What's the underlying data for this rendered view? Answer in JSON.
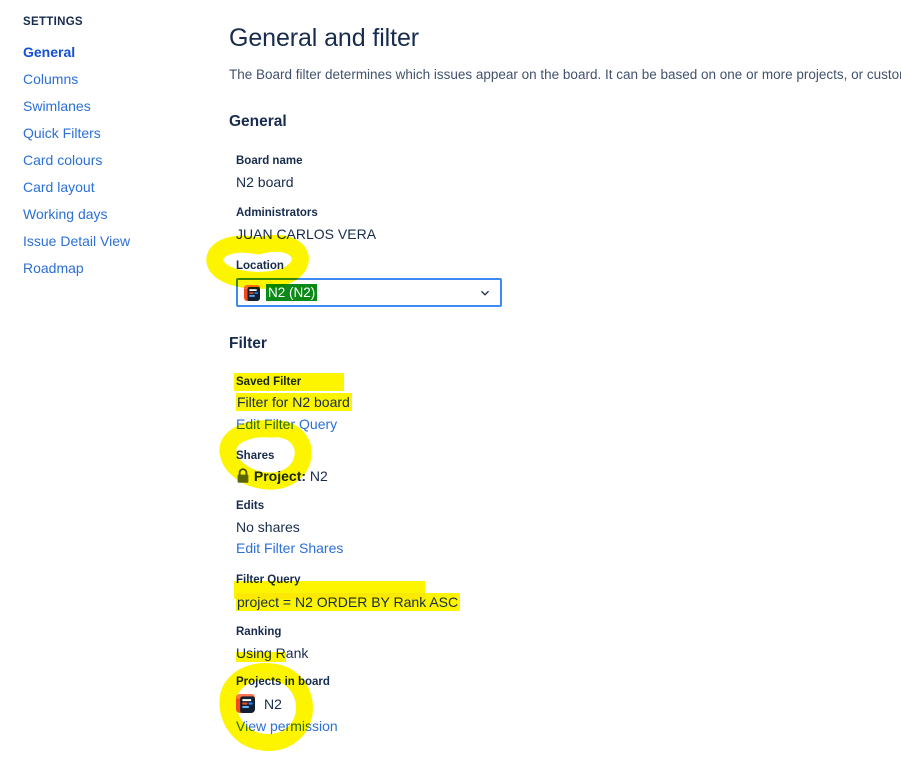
{
  "sidebar": {
    "heading": "SETTINGS",
    "items": [
      {
        "label": "General",
        "active": true
      },
      {
        "label": "Columns",
        "active": false
      },
      {
        "label": "Swimlanes",
        "active": false
      },
      {
        "label": "Quick Filters",
        "active": false
      },
      {
        "label": "Card colours",
        "active": false
      },
      {
        "label": "Card layout",
        "active": false
      },
      {
        "label": "Working days",
        "active": false
      },
      {
        "label": "Issue Detail View",
        "active": false
      },
      {
        "label": "Roadmap",
        "active": false
      }
    ]
  },
  "main": {
    "title": "General and filter",
    "description": "The Board filter determines which issues appear on the board. It can be based on one or more projects, or custom JQL de",
    "general": {
      "heading": "General",
      "board_name_label": "Board name",
      "board_name_value": "N2 board",
      "administrators_label": "Administrators",
      "administrators_value": "JUAN CARLOS VERA",
      "location_label": "Location",
      "location_value": "N2 (N2)",
      "location_icon": "project-avatar-icon",
      "location_chevron": "chevron-down-icon"
    },
    "filter": {
      "heading": "Filter",
      "saved_filter_label": "Saved Filter",
      "saved_filter_value": "Filter for N2 board",
      "edit_filter_query_link": "Edit Filter Query",
      "shares_label": "Shares",
      "shares_icon": "lock-icon",
      "shares_type": "Project:",
      "shares_value": "N2",
      "edits_label": "Edits",
      "edits_value": "No shares",
      "edit_filter_shares_link": "Edit Filter Shares",
      "filter_query_label": "Filter Query",
      "filter_query_value": "project = N2 ORDER BY Rank ASC",
      "ranking_label": "Ranking",
      "ranking_value": "Using Rank",
      "projects_in_board_label": "Projects in board",
      "project_icon": "project-avatar-icon",
      "project_name": "N2",
      "view_permission_link": "View permission"
    }
  },
  "colors": {
    "link": "#2b6fd8",
    "active_link": "#1350d8",
    "text": "#172b4d",
    "highlight": "#fdf400",
    "selection_green": "#0b8a17",
    "focus_border": "#3d8bf2",
    "marker_yellow": "#fdf400"
  }
}
